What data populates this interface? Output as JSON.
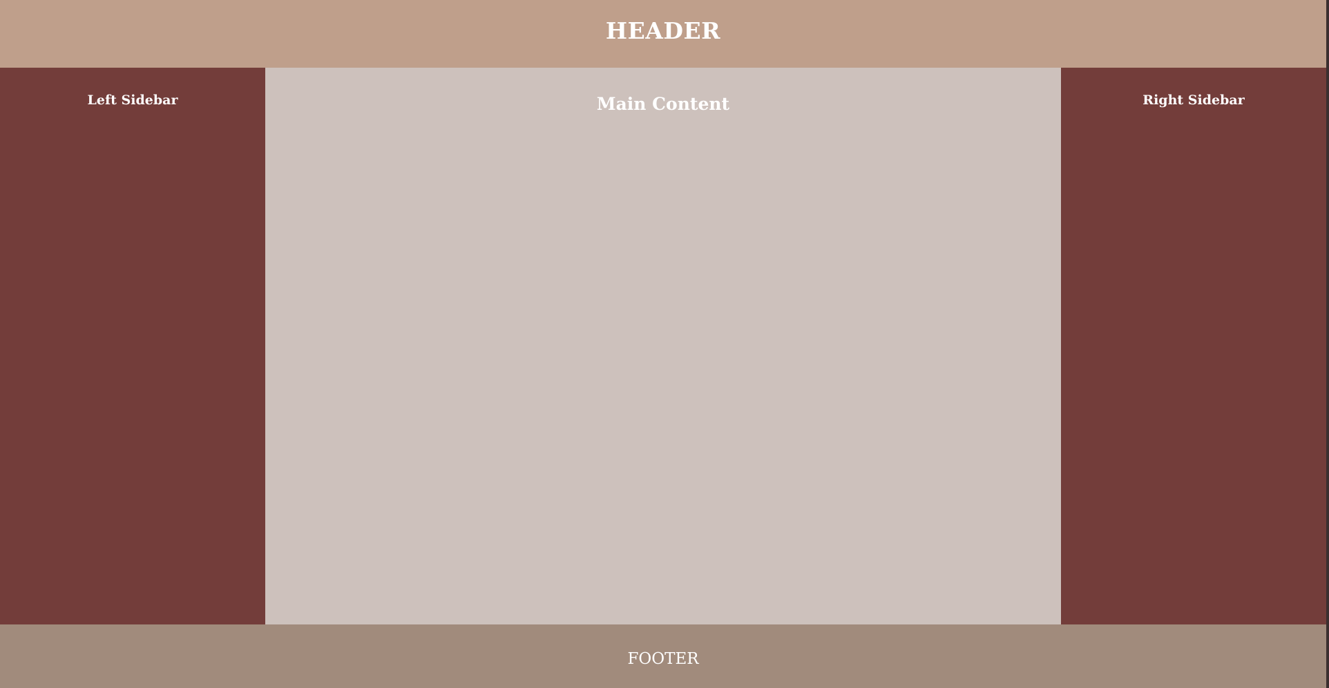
{
  "header": {
    "title": "HEADER",
    "background": "#bf9f8b"
  },
  "left_sidebar": {
    "title": "Left Sidebar",
    "background": "#733d3a"
  },
  "main": {
    "title": "Main Content",
    "background": "#cdc1bc"
  },
  "right_sidebar": {
    "title": "Right Sidebar",
    "background": "#733d3a"
  },
  "footer": {
    "text": "FOOTER",
    "background": "#a18b7c"
  },
  "text_color": "#ffffff"
}
